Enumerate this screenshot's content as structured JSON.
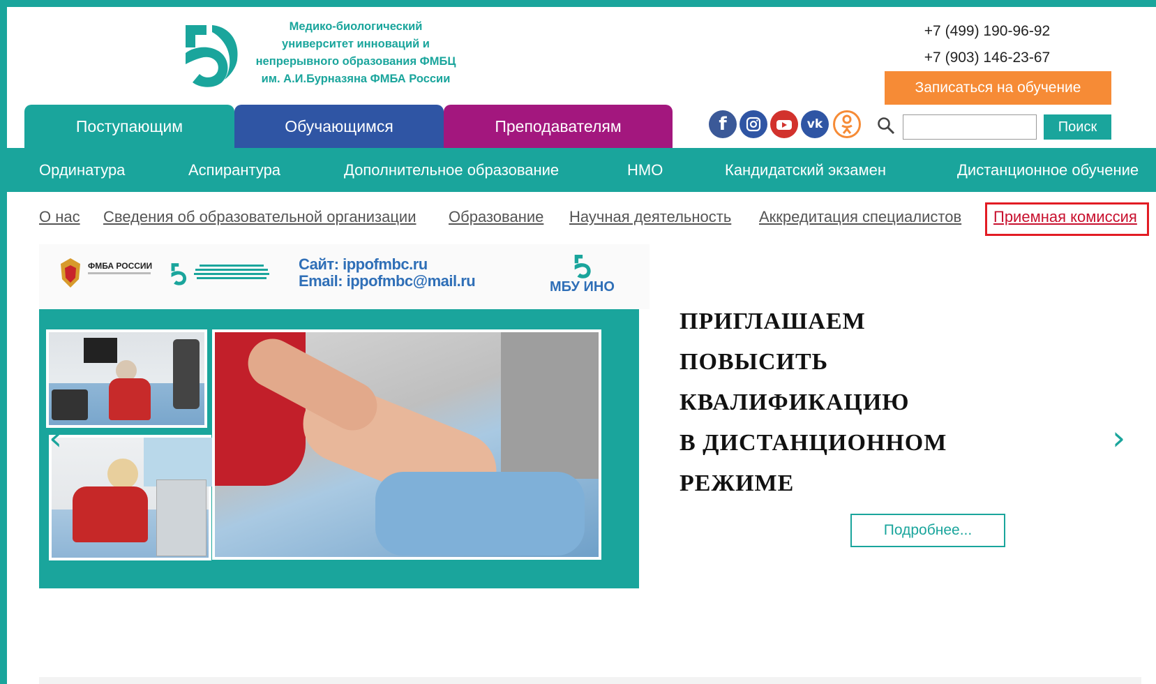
{
  "header": {
    "logo_text": [
      "Медико-биологический",
      "университет инноваций и",
      "непрерывного образования ФМБЦ",
      "им. А.И.Бурназяна ФМБА России"
    ],
    "phones": [
      "+7 (499) 190-96-92",
      "+7 (903) 146-23-67"
    ],
    "enroll_label": "Записаться на обучение",
    "search_button": "Поиск",
    "search_value": ""
  },
  "audience_tabs": [
    {
      "label": "Поступающим",
      "color": "#1aa59c"
    },
    {
      "label": "Обучающимся",
      "color": "#2f55a4"
    },
    {
      "label": "Преподавателям",
      "color": "#a3177e"
    }
  ],
  "social": [
    "facebook-icon",
    "instagram-icon",
    "youtube-icon",
    "vk-icon",
    "odnoklassniki-icon"
  ],
  "main_nav": [
    "Ординатура",
    "Аспирантура",
    "Дополнительное образование",
    "НМО",
    "Кандидатский экзамен",
    "Дистанционное обучение"
  ],
  "sub_nav": [
    "О нас",
    "Сведения об образовательной организации",
    "Образование",
    "Научная деятельность",
    "Аккредитация специалистов",
    "Приемная комиссия"
  ],
  "banner": {
    "org_left": "ФМБА РОССИИ",
    "site": "Сайт: ippofmbc.ru",
    "email": "Email: ippofmbc@mail.ru",
    "mbu": "МБУ ИНО"
  },
  "slide": {
    "lines": [
      "ПРИГЛАШАЕМ",
      "ПОВЫСИТЬ",
      "КВАЛИФИКАЦИЮ",
      "В ДИСТАНЦИОННОМ",
      "РЕЖИМЕ"
    ],
    "more_label": "Подробнее..."
  },
  "colors": {
    "accent": "#1aa59c",
    "orange": "#f68b36",
    "blue": "#2f55a4",
    "purple": "#a3177e",
    "active_red": "#e21c24"
  }
}
